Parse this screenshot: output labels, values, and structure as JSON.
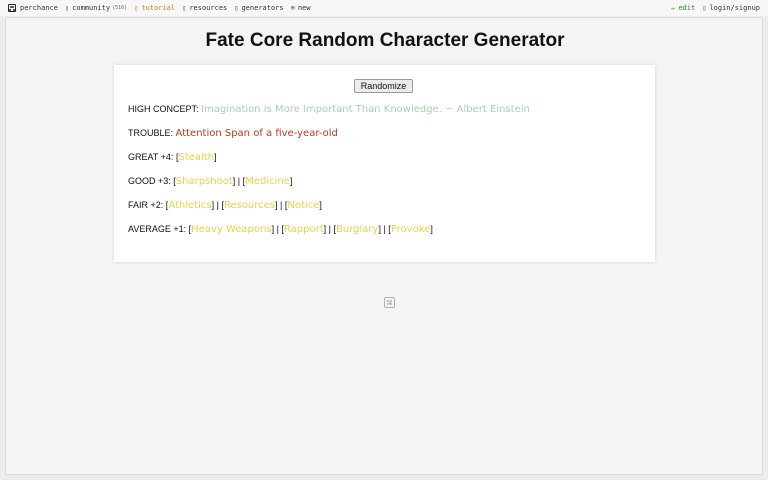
{
  "nav": {
    "brand": "perchance",
    "community": "community",
    "community_count": "(516)",
    "tutorial": "tutorial",
    "resources": "resources",
    "generators": "generators",
    "new": "new",
    "edit": "edit",
    "login": "login/signup",
    "colors": {
      "tutorial": "#e07a1f",
      "edit": "#2e8b2e"
    }
  },
  "page": {
    "title": "Fate Core Random Character Generator",
    "randomize_label": "Randomize"
  },
  "character": {
    "high_concept_label": "HIGH CONCEPT:",
    "high_concept_value": "Imagination is More Important Than Knowledge. ~ Albert Einstein",
    "trouble_label": "TROUBLE:",
    "trouble_value": "Attention Span of a five-year-old",
    "great_label": "GREAT +4:",
    "great_skills": [
      "Stealth"
    ],
    "good_label": "GOOD +3:",
    "good_skills": [
      "Sharpshoot",
      "Medicine"
    ],
    "fair_label": "FAIR +2:",
    "fair_skills": [
      "Athletics",
      "Resources",
      "Notice"
    ],
    "average_label": "AVERAGE +1:",
    "average_skills": [
      "Heavy Weapons",
      "Rapport",
      "Burglary",
      "Provoke"
    ]
  },
  "colors": {
    "high_concept": "#a9cfae",
    "trouble": "#b83a1e",
    "skill": "#e5d24a"
  }
}
